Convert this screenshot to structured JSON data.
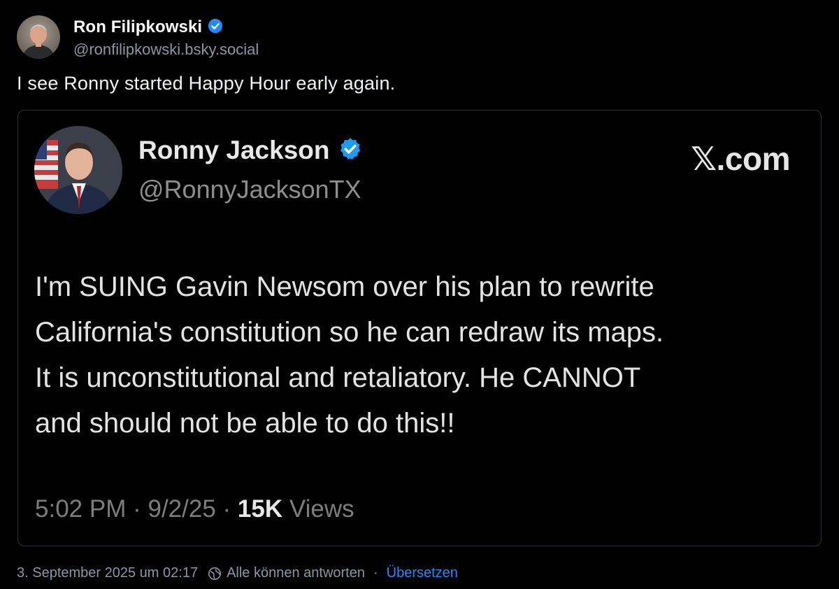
{
  "post": {
    "author_name": "Ron Filipkowski",
    "author_handle": "@ronfilipkowski.bsky.social",
    "text": "I see Ronny started Happy Hour early again."
  },
  "quote": {
    "author_name": "Ronny Jackson",
    "author_handle": "@RonnyJacksonTX",
    "source_label": "𝕏.com",
    "text": "I'm SUING Gavin Newsom over his plan to rewrite\nCalifornia's constitution so he can redraw its maps.\nIt is unconstitutional and retaliatory. He CANNOT\nand should not be able to do this!!",
    "time": "5:02 PM",
    "date": "9/2/25",
    "separator": "·",
    "views_count": "15K",
    "views_label": "Views"
  },
  "footer": {
    "timestamp": "3. September 2025 um 02:17",
    "reply_setting": "Alle können antworten",
    "separator": "·",
    "translate_label": "Übersetzen"
  },
  "icons": {
    "verified": "verified-badge-icon",
    "reply_setting": "globe-reply-icon"
  },
  "colors": {
    "background": "#000000",
    "verified": "#208bfe",
    "link": "#208bfe",
    "muted": "#8a97a6"
  }
}
